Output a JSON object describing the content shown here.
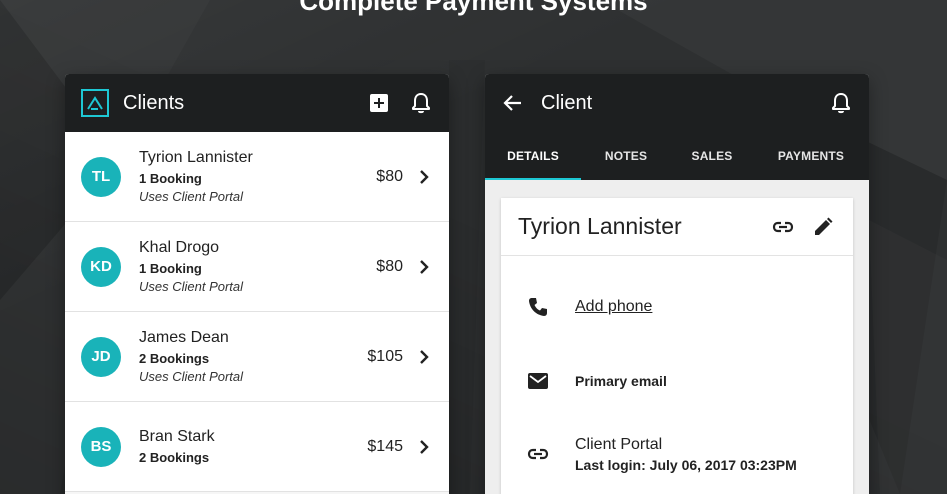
{
  "hero": {
    "title": "Complete Payment Systems"
  },
  "left_phone": {
    "title": "Clients",
    "clients": [
      {
        "initials": "TL",
        "name": "Tyrion Lannister",
        "bookings": "1 Booking",
        "portal": "Uses Client Portal",
        "amount": "$80"
      },
      {
        "initials": "KD",
        "name": "Khal Drogo",
        "bookings": "1 Booking",
        "portal": "Uses Client Portal",
        "amount": "$80"
      },
      {
        "initials": "JD",
        "name": "James Dean",
        "bookings": "2 Bookings",
        "portal": "Uses Client Portal",
        "amount": "$105"
      },
      {
        "initials": "BS",
        "name": "Bran Stark",
        "bookings": "2 Bookings",
        "portal": "",
        "amount": "$145"
      }
    ]
  },
  "right_phone": {
    "title": "Client",
    "tabs": [
      "DETAILS",
      "NOTES",
      "SALES",
      "PAYMENTS"
    ],
    "active_tab": "DETAILS",
    "detail": {
      "name": "Tyrion Lannister",
      "add_phone": "Add phone",
      "email": "Primary email",
      "portal_title": "Client Portal",
      "portal_login": "Last login: July 06, 2017 03:23PM"
    }
  },
  "colors": {
    "accent": "#1ec8d4",
    "avatar": "#19b3b9",
    "appbar": "#1d1f20",
    "background": "#2e3031"
  },
  "icons": {
    "logo": "app-logo-icon",
    "add": "add-box-icon",
    "notifications": "bell-icon",
    "back": "arrow-back-icon",
    "link": "link-icon",
    "edit": "pencil-icon",
    "phone": "phone-icon",
    "email": "mail-icon",
    "chevron": "chevron-right-icon"
  }
}
